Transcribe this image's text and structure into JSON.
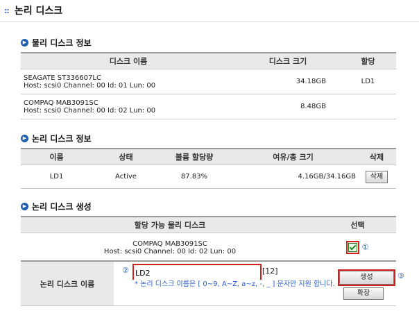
{
  "page": {
    "title": "논리 디스크"
  },
  "physical": {
    "section_title": "물리 디스크 정보",
    "headers": [
      "디스크 이름",
      "디스크 크기",
      "할당"
    ],
    "rows": [
      {
        "name": "SEAGATE ST336607LC",
        "host": "Host: scsi0 Channel: 00 Id: 01 Lun: 00",
        "size": "34.18GB",
        "alloc": "LD1"
      },
      {
        "name": "COMPAQ MAB3091SC",
        "host": "Host: scsi0 Channel: 00 Id: 02 Lun: 00",
        "size": "8.48GB",
        "alloc": ""
      }
    ]
  },
  "logical": {
    "section_title": "논리 디스크 정보",
    "headers": [
      "이름",
      "상태",
      "볼륨 할당량",
      "여유/총 크기",
      "삭제"
    ],
    "rows": [
      {
        "name": "LD1",
        "status": "Active",
        "quota": "87.83%",
        "free_total": "4.16GB/34.16GB",
        "delete_label": "삭제"
      }
    ]
  },
  "create": {
    "section_title": "논리 디스크 생성",
    "headers": [
      "할당 가능 물리 디스크",
      "선택"
    ],
    "disk_name": "COMPAQ MAB3091SC",
    "disk_host": "Host: scsi0 Channel: 00 Id: 02 Lun: 00",
    "marker1": "①",
    "marker2": "②",
    "marker3": "③",
    "name_label": "논리 디스크 이름",
    "name_value": "LD2",
    "max_len": "[12]",
    "note": "* 논리 디스크 이름은 [ 0~9, A~Z, a~z, -, _ ] 문자만 지원 합니다.",
    "create_button": "생성",
    "expand_button": "확장"
  }
}
